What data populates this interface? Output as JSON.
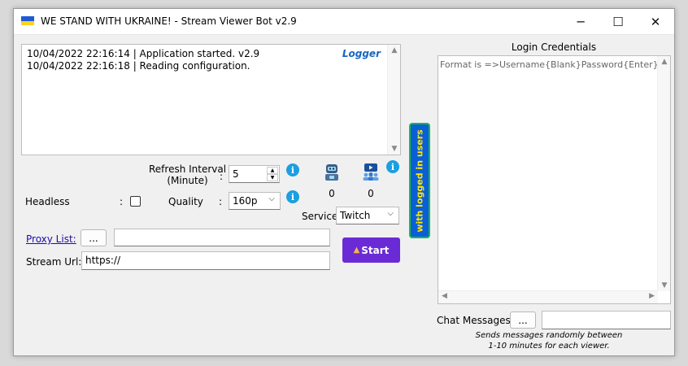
{
  "window": {
    "title": "WE STAND WITH UKRAINE! - Stream Viewer Bot v2.9",
    "flag_colors": [
      "#1f5bd7",
      "#ffd21f"
    ],
    "controls": {
      "minimize": "─",
      "maximize": "☐",
      "close": "✕"
    }
  },
  "logger": {
    "title": "Logger",
    "lines": [
      "10/04/2022 22:16:14 | Application started. v2.9",
      "10/04/2022 22:16:18 | Reading configuration."
    ]
  },
  "settings": {
    "refresh_label_1": "Refresh Interval",
    "refresh_label_2": "(Minute)",
    "refresh_colon": ":",
    "refresh_value": "5",
    "headless_label": "Headless",
    "headless_colon": ":",
    "quality_label": "Quality",
    "quality_colon": ":",
    "quality_value": "160p",
    "service_label": "Service:",
    "service_value": "Twitch"
  },
  "stats": {
    "bot_count": "0",
    "viewer_count": "0"
  },
  "proxy": {
    "label": "Proxy List:",
    "browse_button": "...",
    "value": ""
  },
  "stream": {
    "label": "Stream Url:",
    "value": "https://"
  },
  "start_button": "Start",
  "vertical_tab": "with logged in users",
  "login": {
    "heading": "Login Credentials",
    "placeholder": "Format is =>Username{Blank}Password{Enter}"
  },
  "chat": {
    "label": "Chat Messages :",
    "browse_button": "...",
    "value": "",
    "note_line1": "Sends messages randomly between",
    "note_line2": "1-10 minutes for each viewer."
  },
  "colors": {
    "accent_purple": "#6a2bd6",
    "logger_blue": "#1565c0",
    "tab_blue": "#0a5ed7",
    "tab_yellow": "#ffe600",
    "info_blue": "#1a9fe0"
  }
}
